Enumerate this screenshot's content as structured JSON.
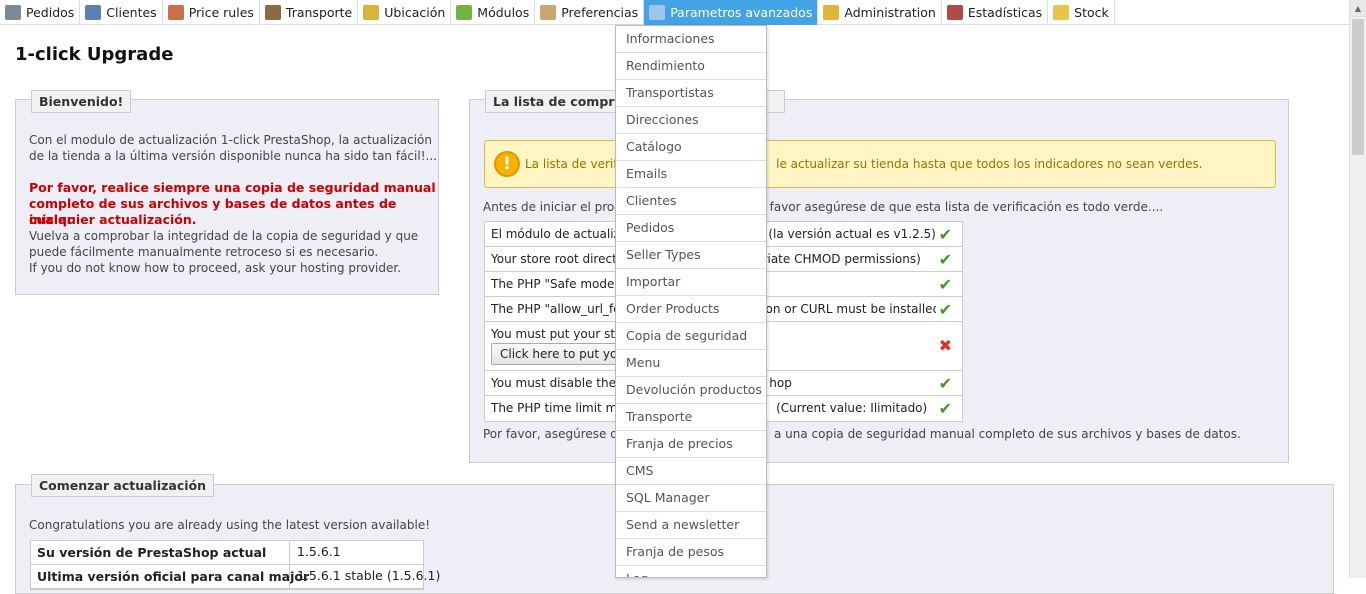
{
  "nav": {
    "tabs": [
      {
        "label": "Pedidos",
        "icon": "cart-icon",
        "color": "#7a8a99"
      },
      {
        "label": "Clientes",
        "icon": "user-icon",
        "color": "#5d7fb3"
      },
      {
        "label": "Price rules",
        "icon": "price-rules-icon",
        "color": "#c9704b"
      },
      {
        "label": "Transporte",
        "icon": "truck-icon",
        "color": "#8b6b43"
      },
      {
        "label": "Ubicación",
        "icon": "globe-icon",
        "color": "#d8b43c"
      },
      {
        "label": "Módulos",
        "icon": "puzzle-icon",
        "color": "#6fb43f"
      },
      {
        "label": "Preferencias",
        "icon": "preferences-icon",
        "color": "#c8a870"
      },
      {
        "label": "Parametros avanzados",
        "icon": "wrench-icon",
        "color": "#9cc6ea"
      },
      {
        "label": "Administration",
        "icon": "key-icon",
        "color": "#e3b53a"
      },
      {
        "label": "Estadísticas",
        "icon": "bar-chart-icon",
        "color": "#b04a4a"
      },
      {
        "label": "Stock",
        "icon": "stock-icon",
        "color": "#e9c44a"
      }
    ]
  },
  "page": {
    "title": "1-click Upgrade"
  },
  "welcome": {
    "legend": "Bienvenido!",
    "intro1": "Con el modulo de actualización 1-click PrestaShop, la actualización",
    "intro2": "de la tienda a la última versión disponible nunca ha sido tan fácil!...",
    "warn1": "Por favor, realice siempre una copia de seguridad manual",
    "warn2": "completo de sus archivos y bases de datos antes de iniciar",
    "warn3": "cualquier actualización.",
    "check1": "Vuelva a comprobar la integridad de la copia de seguridad y que",
    "check2": "puede fácilmente manualmente retroceso si es necesario.",
    "hosting": "If you do not know how to proceed, ask your hosting provider."
  },
  "checklist": {
    "legend": "La lista de comprob",
    "warning": "La lista de verific                                       le actualizar su tienda hasta que todos los indicadores no sean verdes.",
    "before": "Antes de iniciar el proc                                       favor asegúrese de que esta lista de verificación es todo verde....",
    "items": [
      {
        "label": "El módulo de actualiza                                     (la versión actual es v1.2.5)",
        "status": "✔"
      },
      {
        "label": "Your store root director                                   riate CHMOD permissions)",
        "status": "✔"
      },
      {
        "label": "The PHP \"Safe mode\"",
        "status": "✔"
      },
      {
        "label": "The PHP \"allow_url_fo                                      on or CURL must be installed",
        "status": "✔"
      },
      {
        "label": "You must put your store",
        "button": "Click here to put your",
        "status": "✖"
      },
      {
        "label": "You must disable the C                                     hop",
        "status": "✔"
      },
      {
        "label": "The PHP time limit mus                                      (Current value: Ilimitado)",
        "status": "✔"
      }
    ],
    "footer": "Por favor, asegúrese de                                       a una copia de seguridad manual completo de sus archivos y bases de datos."
  },
  "upgrade": {
    "legend": "Comenzar actualización",
    "congrats": "Congratulations you are already using the latest version available!",
    "rows": [
      {
        "key": "Su versión de PrestaShop actual",
        "value": "1.5.6.1"
      },
      {
        "key": "Ultima versión oficial para canal major",
        "value": "1.5.6.1 stable (1.5.6.1)"
      }
    ]
  },
  "dropdown": {
    "items": [
      "Informaciones",
      "Rendimiento",
      "Transportistas",
      "Direcciones",
      "Catálogo",
      "Emails",
      "Clientes",
      "Pedidos",
      "Seller Types",
      "Importar",
      "Order Products",
      "Copia de seguridad",
      "Menu",
      "Devolución productos",
      "Transporte",
      "Franja de precios",
      "CMS",
      "SQL Manager",
      "Send a newsletter",
      "Franja de pesos",
      "Log"
    ]
  },
  "colors": {
    "active_tab": "#42a3e6",
    "ok": "#3c9c1c",
    "ko": "#e0302a",
    "warning_bg": "#fff6c3"
  }
}
